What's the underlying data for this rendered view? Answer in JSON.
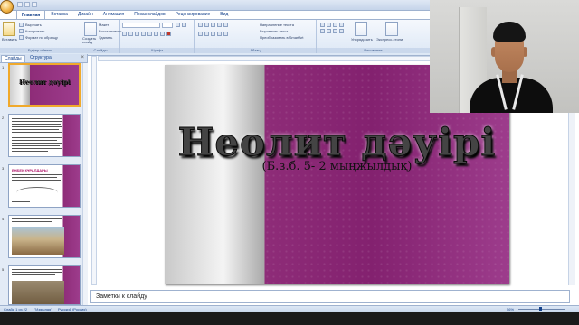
{
  "ribbon": {
    "tabs": [
      "Главная",
      "Вставка",
      "Дизайн",
      "Анимация",
      "Показ слайдов",
      "Рецензирование",
      "Вид"
    ],
    "active_tab": "Главная",
    "clipboard": {
      "paste": "Вставить",
      "cut": "Вырезать",
      "copy": "Копировать",
      "format_painter": "Формат по образцу",
      "group": "Буфер обмена"
    },
    "slides_group": {
      "create_slide": "Создать слайд",
      "layout": "Макет",
      "restore": "Восстановить",
      "delete": "Удалить",
      "group": "Слайды"
    },
    "font_group": "Шрифт",
    "paragraph_group": {
      "text_direction": "Направление текста",
      "align_text": "Выровнять текст",
      "smartart": "Преобразовать в SmartArt",
      "group": "Абзац"
    },
    "drawing_group": {
      "arrange": "Упорядочить",
      "quick_styles": "Экспресс-стили",
      "group": "Рисование"
    }
  },
  "left_panel": {
    "tabs": [
      "Слайды",
      "Структура"
    ],
    "thumbnails": [
      {
        "num": "1",
        "title": "Неолит дәуірі"
      },
      {
        "num": "2",
        "title": ""
      },
      {
        "num": "3",
        "title": "ЕҢБЕК ҚҰРАЛДАРЫ"
      },
      {
        "num": "4",
        "title": ""
      },
      {
        "num": "5",
        "title": ""
      }
    ]
  },
  "slide": {
    "title": "Неолит дәуірі",
    "subtitle": "(Б.з.б. 5- 2 мыңжылдық)"
  },
  "notes": {
    "placeholder": "Заметки к слайду"
  },
  "statusbar": {
    "slide_counter": "Слайд 1 из 22",
    "theme": "\"Изящная\"",
    "language": "Русский (Россия)",
    "zoom": "56%"
  },
  "colors": {
    "slide_purple": "#83216f",
    "ribbon_blue": "#15428b"
  }
}
